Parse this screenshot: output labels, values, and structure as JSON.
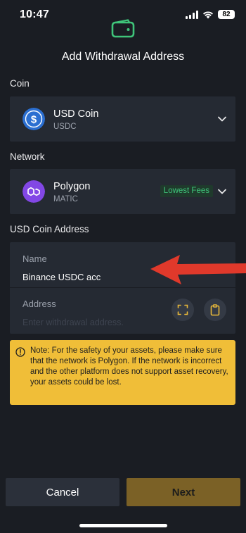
{
  "status_bar": {
    "time": "10:47",
    "battery": "82"
  },
  "header": {
    "title": "Add Withdrawal Address"
  },
  "coin": {
    "label": "Coin",
    "name": "USD Coin",
    "symbol": "USDC",
    "icon": "usdc-icon"
  },
  "network": {
    "label": "Network",
    "name": "Polygon",
    "symbol": "MATIC",
    "badge": "Lowest Fees",
    "icon": "polygon-icon"
  },
  "address_form": {
    "label": "USD Coin Address",
    "name_label": "Name",
    "name_value": "Binance USDC acc",
    "address_label": "Address",
    "address_placeholder": "Enter withdrawal address."
  },
  "note": {
    "text": "Note: For the safety of your assets, please make sure that the network is Polygon. If the network is incorrect and the other platform does not support asset recovery, your assets could be lost."
  },
  "buttons": {
    "cancel": "Cancel",
    "next": "Next"
  },
  "colors": {
    "background": "#1a1d23",
    "card": "#252a33",
    "accent_green": "#3fc47a",
    "note_bg": "#f0be38",
    "next_bg": "#7b6126",
    "annotation_arrow": "#e0392b"
  }
}
